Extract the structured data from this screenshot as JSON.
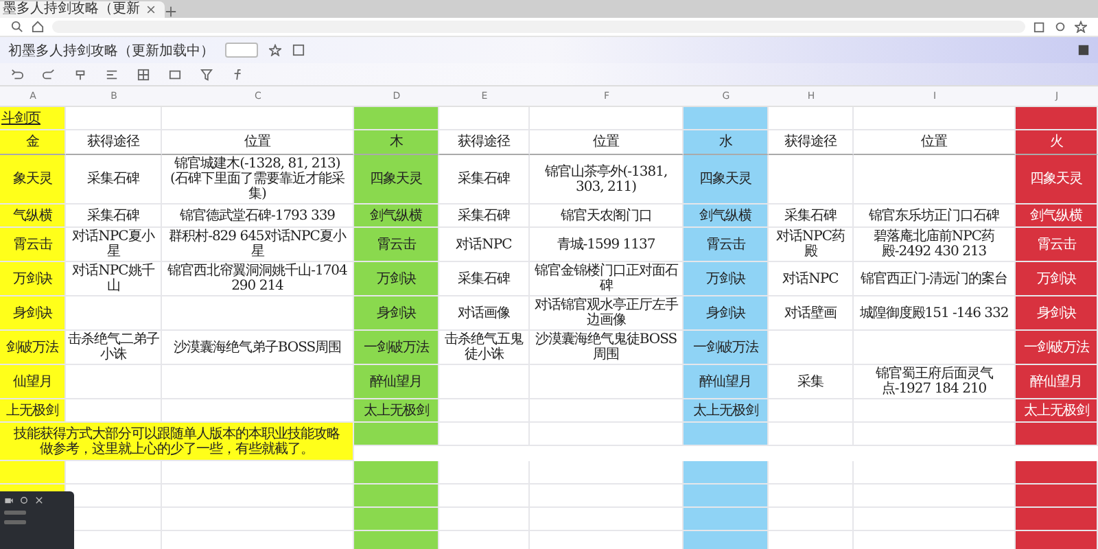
{
  "browser": {
    "tab_title": "墨多人持剑攻略（更新"
  },
  "document": {
    "title": "初墨多人持剑攻略（更新加载中）"
  },
  "sheet": {
    "columns": [
      {
        "letter": "A",
        "color": "#ffff1a"
      },
      {
        "letter": "B"
      },
      {
        "letter": "C"
      },
      {
        "letter": "D",
        "color": "#8ad94e"
      },
      {
        "letter": "E"
      },
      {
        "letter": "F"
      },
      {
        "letter": "G",
        "color": "#8fd3f5"
      },
      {
        "letter": "H"
      },
      {
        "letter": "I"
      },
      {
        "letter": "J",
        "color": "#d8323f"
      }
    ],
    "sheet_title": "斗剑页",
    "header": [
      "金",
      "获得途径",
      "位置",
      "木",
      "获得途径",
      "位置",
      "水",
      "获得途径",
      "位置",
      "火"
    ],
    "rows": [
      [
        "象天灵",
        "采集石碑",
        "锦官城建木(-1328, 81, 213)\n(石碑下里面了需要靠近才能采集)",
        "四象天灵",
        "采集石碑",
        "锦官山茶亭外(-1381, 303, 211)",
        "四象天灵",
        null,
        null,
        "四象天灵"
      ],
      [
        "气纵横",
        "采集石碑",
        "锦官德武堂石碑-1793 339",
        "剑气纵横",
        "采集石碑",
        "锦官天农阁门口",
        "剑气纵横",
        "采集石碑",
        "锦官东乐坊正门口石碑",
        "剑气纵横"
      ],
      [
        "霄云击",
        "对话NPC夏小星",
        "群积村-829 645对话NPC夏小星",
        "霄云击",
        "对话NPC",
        "青城-1599 1137",
        "霄云击",
        "对话NPC药殿",
        "碧落庵北庙前NPC药殿-2492 430 213",
        "霄云击"
      ],
      [
        "万剑诀",
        "对话NPC姚千山",
        "锦官西北帘翼洞洞姚千山-1704 290 214",
        "万剑诀",
        "采集石碑",
        "锦官金锦楼门口正对面石碑",
        "万剑诀",
        "对话NPC",
        "锦官西正门-清远门的案台",
        "万剑诀"
      ],
      [
        "身剑诀",
        null,
        null,
        "身剑诀",
        "对话画像",
        "对话锦官观水亭正厅左手边画像",
        "身剑诀",
        "对话壁画",
        "城隍御度殿151 -146 332",
        "身剑诀"
      ],
      [
        "剑破万法",
        "击杀绝气二弟子小诛",
        "沙漠囊海绝气弟子BOSS周围",
        "一剑破万法",
        "击杀绝气五鬼徒小诛",
        "沙漠囊海绝气鬼徒BOSS周围",
        "一剑破万法",
        null,
        null,
        "一剑破万法"
      ],
      [
        "仙望月",
        null,
        null,
        "醉仙望月",
        null,
        null,
        "醉仙望月",
        "采集",
        "锦官蜀王府后面灵气点-1927 184 210",
        "醉仙望月"
      ],
      [
        "上无极剑",
        null,
        null,
        "太上无极剑",
        null,
        null,
        "太上无极剑",
        null,
        null,
        "太上无极剑"
      ]
    ],
    "note": "技能获得方式大部分可以跟随单人版本的本职业技能攻略做参考，这里就上心的少了一些，有些就截了。"
  }
}
